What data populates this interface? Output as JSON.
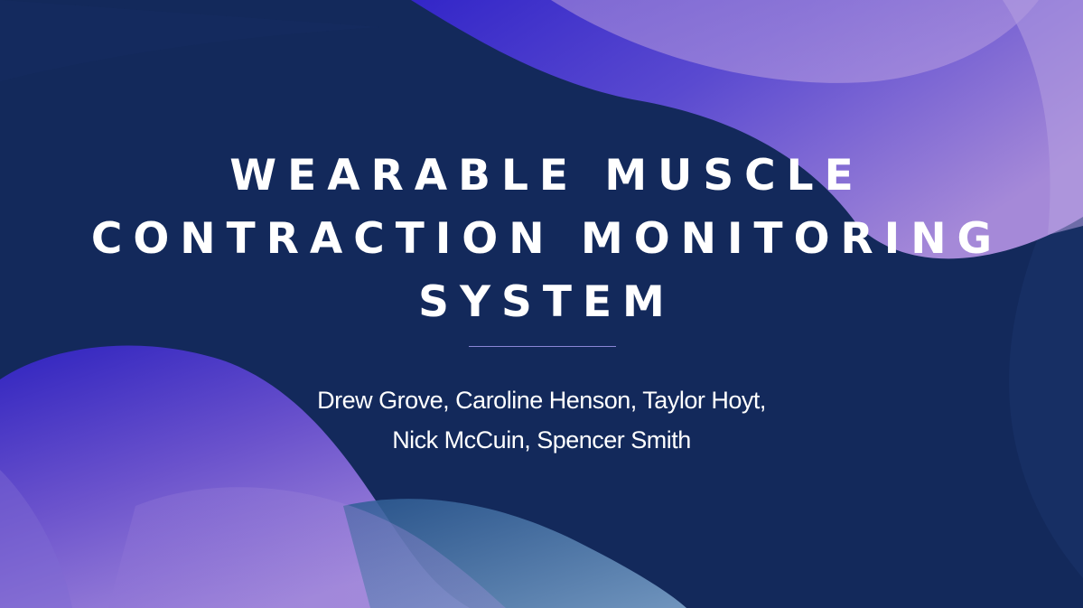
{
  "slide": {
    "title_lines": [
      "Wearable Muscle",
      "Contraction Monitoring",
      "System"
    ],
    "subtitle_lines": [
      "Drew Grove, Caroline Henson, Taylor Hoyt,",
      "Nick McCuin, Spencer Smith"
    ],
    "colors": {
      "background": "#13295b",
      "accent_violet": "#8a6cd0",
      "accent_indigo": "#3a2bc4",
      "text": "#ffffff"
    }
  }
}
